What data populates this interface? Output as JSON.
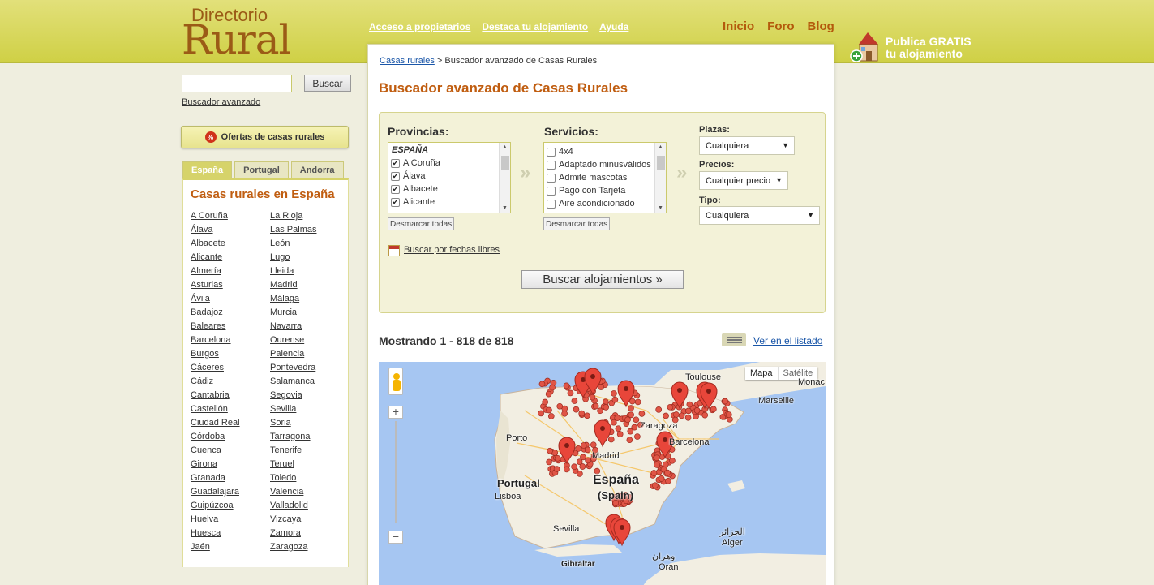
{
  "header": {
    "logo_small": "Directorio",
    "logo_big": "Rural",
    "top_links": [
      "Acceso a propietarios",
      "Destaca tu alojamiento",
      "Ayuda"
    ],
    "nav": [
      "Inicio",
      "Foro",
      "Blog"
    ],
    "publica": {
      "line1": "Publica GRATIS",
      "line2": "tu alojamiento",
      "icon": "house-add-icon"
    }
  },
  "sidebar": {
    "search_placeholder": "",
    "search_button": "Buscar",
    "advanced_link": "Buscador avanzado",
    "ofertas": "Ofertas de casas rurales",
    "tabs": [
      "España",
      "Portugal",
      "Andorra"
    ],
    "active_tab": "España",
    "panel_title": "Casas rurales en España",
    "provinces_col1": [
      "A Coruña",
      "Álava",
      "Albacete",
      "Alicante",
      "Almería",
      "Asturias",
      "Ávila",
      "Badajoz",
      "Baleares",
      "Barcelona",
      "Burgos",
      "Cáceres",
      "Cádiz",
      "Cantabria",
      "Castellón",
      "Ciudad Real",
      "Córdoba",
      "Cuenca",
      "Girona",
      "Granada",
      "Guadalajara",
      "Guipúzcoa",
      "Huelva",
      "Huesca",
      "Jaén"
    ],
    "provinces_col2": [
      "La Rioja",
      "Las Palmas",
      "León",
      "Lugo",
      "Lleida",
      "Madrid",
      "Málaga",
      "Murcia",
      "Navarra",
      "Ourense",
      "Palencia",
      "Pontevedra",
      "Salamanca",
      "Segovia",
      "Sevilla",
      "Soria",
      "Tarragona",
      "Tenerife",
      "Teruel",
      "Toledo",
      "Valencia",
      "Valladolid",
      "Vizcaya",
      "Zamora",
      "Zaragoza"
    ]
  },
  "breadcrumb": {
    "link": "Casas rurales",
    "sep": ">",
    "current": "Buscador avanzado de Casas Rurales"
  },
  "title": "Buscador avanzado de Casas Rurales",
  "form": {
    "provincias_label": "Provincias:",
    "provincias_group": "ESPAÑA",
    "provincias_items": [
      "A Coruña",
      "Álava",
      "Albacete",
      "Alicante"
    ],
    "servicios_label": "Servicios:",
    "servicios_items": [
      "4x4",
      "Adaptado minusválidos",
      "Admite mascotas",
      "Pago con Tarjeta",
      "Aire acondicionado"
    ],
    "desmarcar": "Desmarcar todas",
    "plazas_label": "Plazas:",
    "plazas_value": "Cualquiera",
    "precios_label": "Precios:",
    "precios_value": "Cualquier precio",
    "tipo_label": "Tipo:",
    "tipo_value": "Cualquiera",
    "fechas_link": "Buscar por fechas libres",
    "submit": "Buscar alojamientos »"
  },
  "results": {
    "count_text": "Mostrando 1 - 818 de 818",
    "list_link": "Ver en el listado"
  },
  "map": {
    "type_buttons": [
      "Mapa",
      "Satélite"
    ],
    "zoom_in": "+",
    "zoom_out": "−",
    "labels": {
      "toulouse": "Toulouse",
      "monaco": "Monac",
      "marseille": "Marseille",
      "zaragoza": "Zaragoza",
      "barcelona": "Barcelona",
      "porto": "Porto",
      "portugal": "Portugal",
      "lisboa": "Lisboa",
      "madrid": "Madrid",
      "espana": "España",
      "spain": "(Spain)",
      "sevilla": "Sevilla",
      "gibraltar": "Gibraltar",
      "argel_ar": "الجزائر",
      "alger": "Alger",
      "oran_ar": "وهران",
      "oran": "Oran"
    }
  }
}
